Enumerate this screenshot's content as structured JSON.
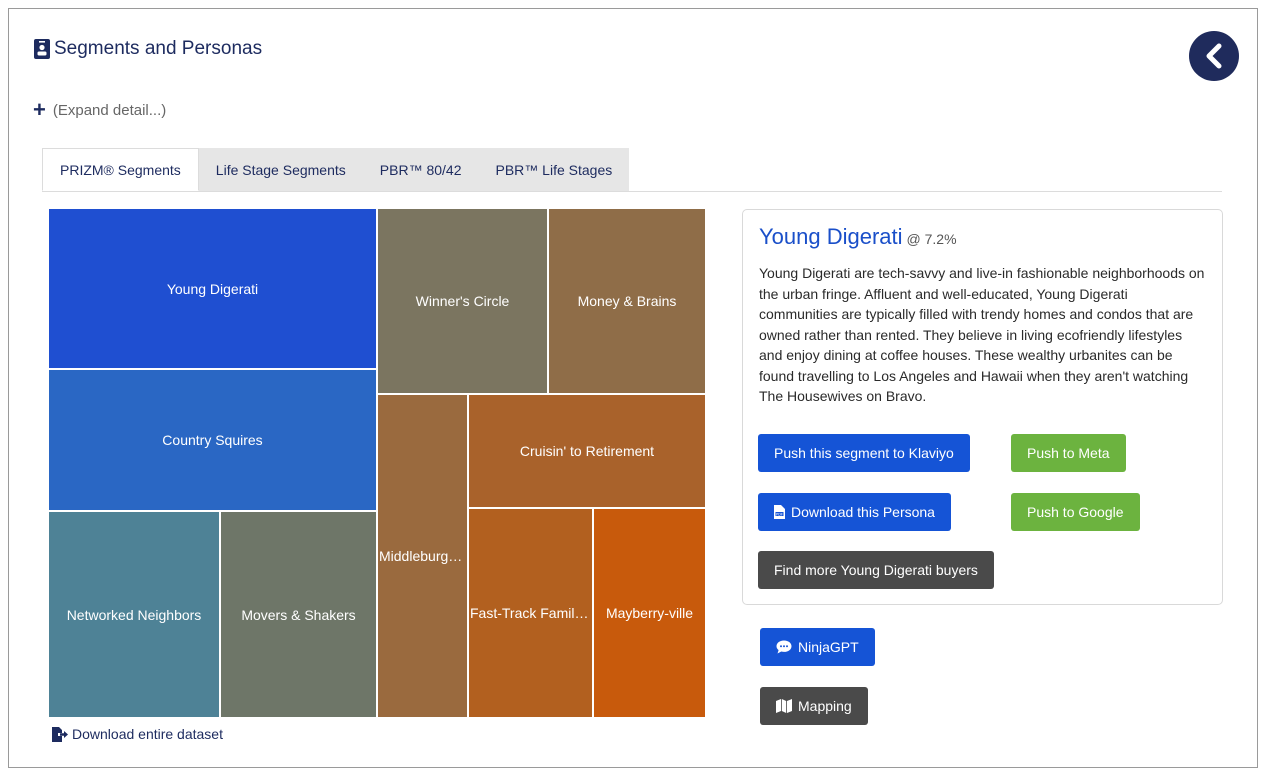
{
  "header": {
    "title": "Segments and Personas",
    "icon": "id-badge-icon"
  },
  "expand": {
    "label": "(Expand detail...)"
  },
  "tabs": [
    {
      "label": "PRIZM® Segments",
      "active": true
    },
    {
      "label": "Life Stage Segments",
      "active": false
    },
    {
      "label": "PBR™ 80/42",
      "active": false
    },
    {
      "label": "PBR™ Life Stages",
      "active": false
    }
  ],
  "treemap": {
    "cells": [
      {
        "label": "Young Digerati",
        "color": "#1f4fd1"
      },
      {
        "label": "Country Squires",
        "color": "#2a67c4"
      },
      {
        "label": "Networked Neighbors",
        "color": "#4e8296"
      },
      {
        "label": "Movers & Shakers",
        "color": "#6e7668"
      },
      {
        "label": "Winner's Circle",
        "color": "#7b7560"
      },
      {
        "label": "Money & Brains",
        "color": "#8f6d48"
      },
      {
        "label": "Middleburg Managers",
        "color": "#9a6a3e"
      },
      {
        "label": "Cruisin' to Retirement",
        "color": "#a9622b"
      },
      {
        "label": "Fast-Track Families",
        "color": "#b2601f"
      },
      {
        "label": "Mayberry-ville",
        "color": "#c85a0c"
      }
    ]
  },
  "download_all": {
    "label": "Download entire dataset"
  },
  "persona": {
    "name": "Young Digerati",
    "pct": "@ 7.2%",
    "description": "Young Digerati are tech-savvy and live-in fashionable neighborhoods on the urban fringe. Affluent and well-educated, Young Digerati communities are typically filled with trendy homes and condos that are owned rather than rented. They believe in living ecofriendly lifestyles and enjoy dining at coffee houses. These wealthy urbanites can be found travelling to Los Angeles and Hawaii when they aren't watching The Housewives on Bravo.",
    "buttons": {
      "klaviyo": "Push this segment to Klaviyo",
      "meta": "Push to Meta",
      "download": "Download this Persona",
      "google": "Push to Google",
      "find_more": "Find more Young Digerati buyers"
    }
  },
  "side_buttons": {
    "ninjagpt": "NinjaGPT",
    "mapping": "Mapping"
  },
  "colors": {
    "navy": "#1f2b5c",
    "blue": "#1554d6",
    "green": "#6cb33f",
    "dark": "#4a4a4a"
  }
}
